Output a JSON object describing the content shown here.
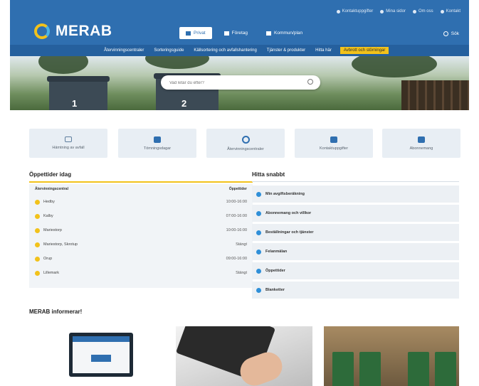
{
  "header": {
    "logo_text": "MERAB",
    "top_links": [
      "Kontaktuppgifter",
      "Mina sidor",
      "Om oss",
      "Kontakt"
    ],
    "main_tabs": [
      "Privat",
      "Företag",
      "Kommun/plan"
    ],
    "search_label": "Sök",
    "subnav": [
      "Återvinningscentraler",
      "Sorteringsguide",
      "Källsortering och avfallshantering",
      "Tjänster & produkter",
      "Hitta här",
      "Avbrott och störningar"
    ]
  },
  "hero": {
    "search_placeholder": "Vad letar du efter?",
    "bin_numbers": [
      "1",
      "2"
    ]
  },
  "tiles": [
    {
      "label": "Hämtning av avfall",
      "icon": "truck-icon"
    },
    {
      "label": "Tömningsdagar",
      "icon": "trash-icon"
    },
    {
      "label": "Återvinningscentraler",
      "icon": "recycle-icon"
    },
    {
      "label": "Kontaktuppgifter",
      "icon": "contact-card-icon"
    },
    {
      "label": "Abonnemang",
      "icon": "calendar-icon"
    }
  ],
  "opening": {
    "title": "Öppettider idag",
    "col_left": "Återvinningscentral",
    "col_right": "Öppettider",
    "rows": [
      {
        "name": "Hedby",
        "time": "10:00-16:00"
      },
      {
        "name": "Kalby",
        "time": "07:00-16:00"
      },
      {
        "name": "Mariestorp",
        "time": "10:00-16:00"
      },
      {
        "name": "Mariestorp, Skrotup",
        "time": "Stängt"
      },
      {
        "name": "Orup",
        "time": "09:00-16:00"
      },
      {
        "name": "Lillemark",
        "time": "Stängt"
      }
    ]
  },
  "find": {
    "title": "Hitta snabbt",
    "links": [
      "Min avgiftsberäkning",
      "Abonnemang och villkor",
      "Beställningar och tjänster",
      "Felanmälan",
      "Öppettider",
      "Blanketter"
    ]
  },
  "info": {
    "title": "MERAB informerar!"
  },
  "colors": {
    "brand_blue": "#2f6fb0",
    "accent_yellow": "#f2c21b",
    "link_dot": "#2f8fd8"
  }
}
